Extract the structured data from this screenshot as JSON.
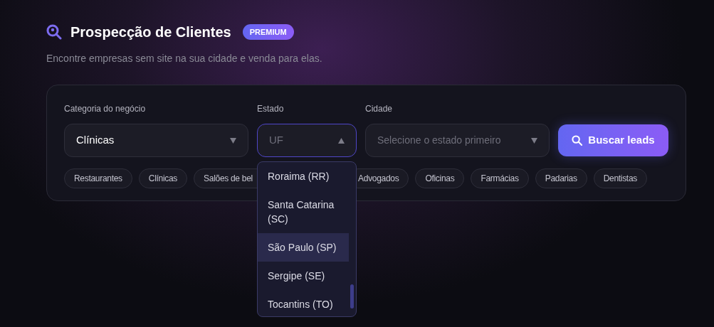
{
  "header": {
    "title": "Prospecção de Clientes",
    "badge": "PREMIUM",
    "subtitle": "Encontre empresas sem site na sua cidade e venda para elas."
  },
  "form": {
    "category": {
      "label": "Categoria do negócio",
      "value": "Clínicas"
    },
    "state": {
      "label": "Estado",
      "placeholder": "UF",
      "expanded": true
    },
    "city": {
      "label": "Cidade",
      "placeholder": "Selecione o estado primeiro"
    },
    "search_button": "Buscar leads"
  },
  "chips": [
    "Restaurantes",
    "Clínicas",
    "Salões de bel",
    "Advogados",
    "Oficinas",
    "Farmácias",
    "Padarias",
    "Dentistas"
  ],
  "state_options": [
    {
      "label": "Roraima (RR)",
      "selected": false
    },
    {
      "label": "Santa Catarina (SC)",
      "selected": false
    },
    {
      "label": "São Paulo (SP)",
      "selected": true
    },
    {
      "label": "Sergipe (SE)",
      "selected": false
    },
    {
      "label": "Tocantins (TO)",
      "selected": false
    }
  ]
}
